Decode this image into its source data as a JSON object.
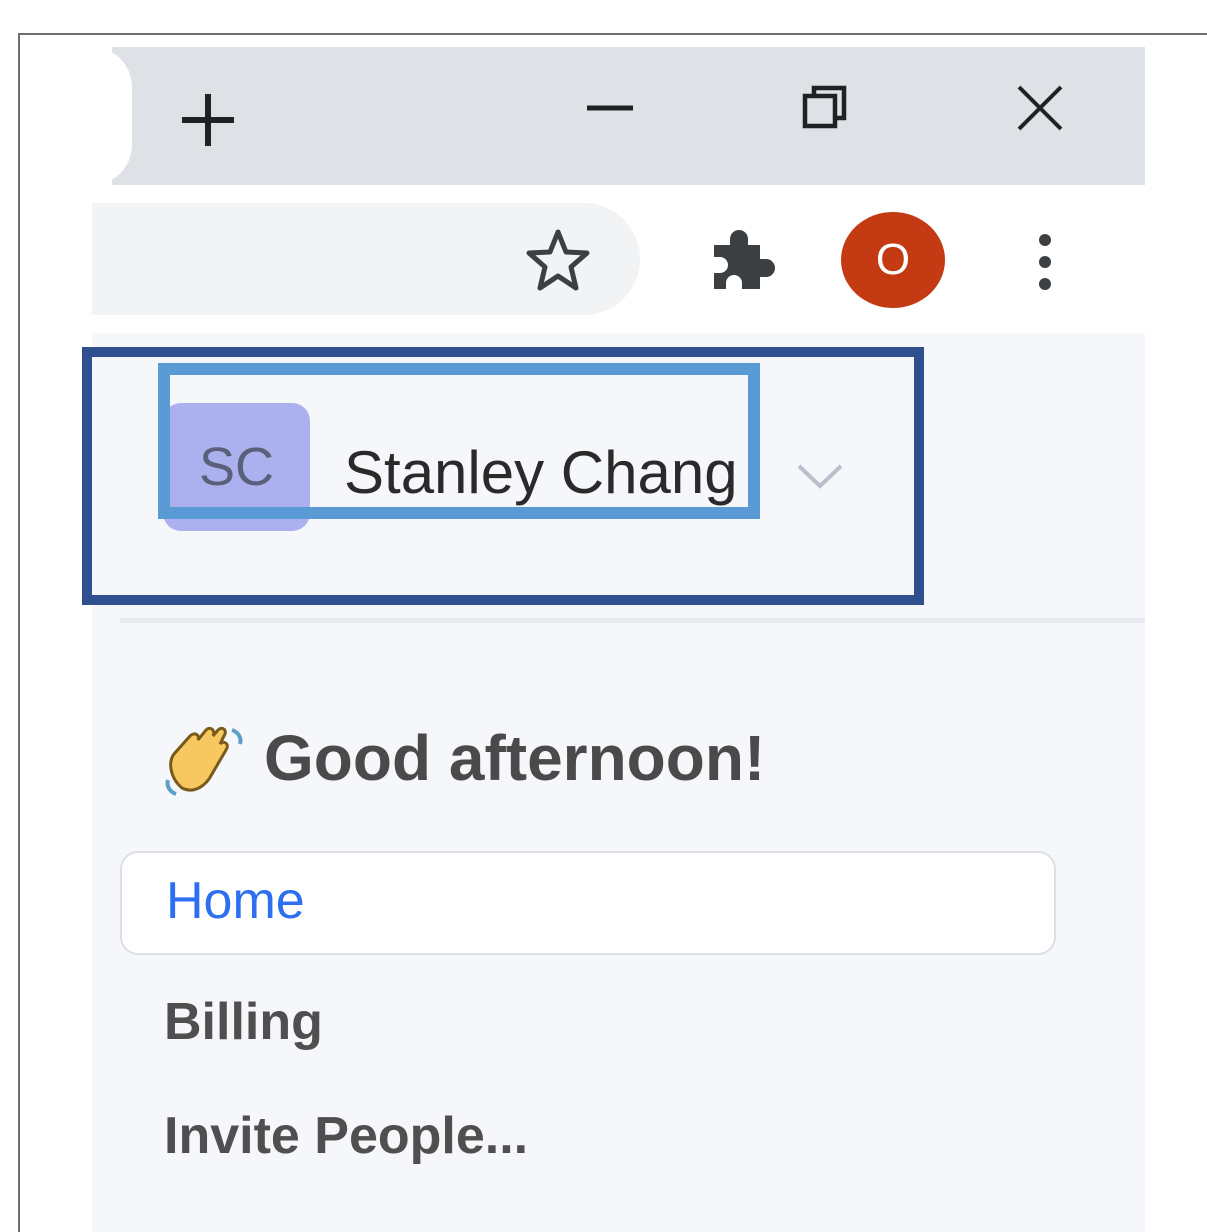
{
  "browser": {
    "tab_strip": {
      "new_tab_icon": "plus-icon",
      "window_controls": [
        "minimize-icon",
        "restore-icon",
        "close-icon"
      ]
    },
    "toolbar": {
      "bookmark_icon": "star-outline-icon",
      "extensions_icon": "puzzle-icon",
      "profile_initial": "O",
      "menu_icon": "kebab-menu-icon"
    },
    "colors": {
      "profile_avatar": "#c43a12",
      "tab_strip_bg": "#dee1e6"
    }
  },
  "account": {
    "initials": "SC",
    "name": "Stanley Chang",
    "avatar_color": "#aab1ee",
    "chevron_icon": "chevron-down-icon"
  },
  "greeting": {
    "icon": "waving-hand-icon",
    "text": "Good afternoon!"
  },
  "nav": {
    "items": [
      {
        "label": "Home",
        "active": true
      },
      {
        "label": "Billing",
        "active": false
      },
      {
        "label": "Invite People...",
        "active": false
      }
    ],
    "active_color": "#2d6ff0"
  }
}
